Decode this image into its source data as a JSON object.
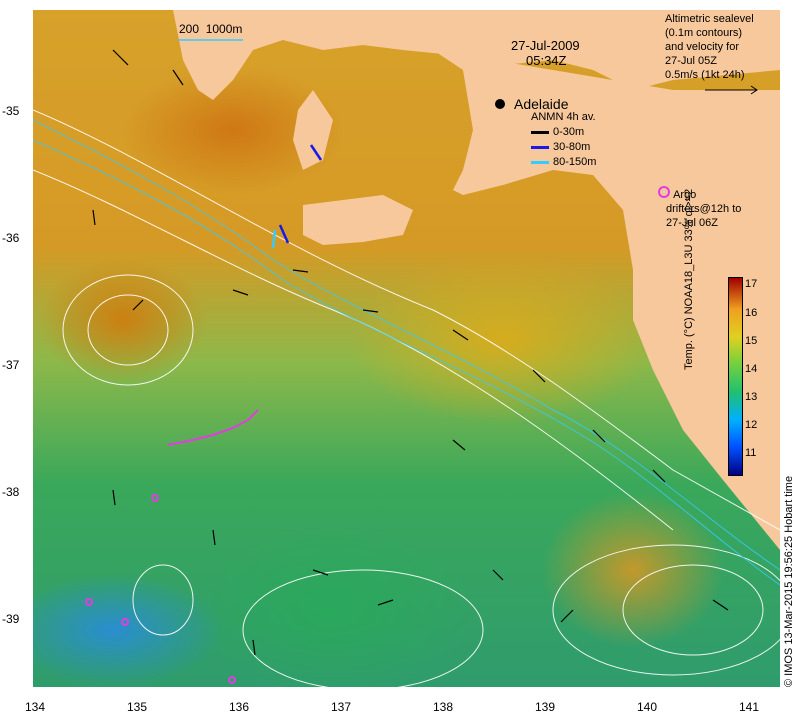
{
  "map": {
    "date": "27-Jul-2009",
    "time": "05:34Z",
    "scale_bar": "200",
    "scale_depth": "1000m",
    "city": "Adelaide"
  },
  "legend_sealevel": {
    "line1": "Altimetric sealevel",
    "line2": "(0.1m contours)",
    "line3": "and velocity for",
    "line4": "27-Jul 05Z",
    "line5": "0.5m/s (1kt 24h)"
  },
  "legend_anmn": {
    "title": "ANMN 4h av.",
    "items": [
      {
        "label": "0-30m",
        "color": "#000000"
      },
      {
        "label": "30-80m",
        "color": "#1a1ae6"
      },
      {
        "label": "80-150m",
        "color": "#33ccff"
      }
    ]
  },
  "legend_argo": {
    "line1": "Argo",
    "line2": "drifters@12h to",
    "line3": "27-Jul 06Z",
    "color": "#e23ce2"
  },
  "colorbar": {
    "title": "Temp. (°C) NOAA18_L3U 33% ql>=2",
    "ticks": [
      "11",
      "12",
      "13",
      "14",
      "15",
      "16",
      "17"
    ],
    "colors": [
      "#000080",
      "#0050ff",
      "#00b0ff",
      "#20c070",
      "#70d040",
      "#e0d020",
      "#f0a020",
      "#e05010",
      "#a00000"
    ]
  },
  "axes": {
    "x_ticks": [
      "134",
      "135",
      "136",
      "137",
      "138",
      "139",
      "140",
      "141"
    ],
    "y_ticks": [
      "-35",
      "-36",
      "-37",
      "-38",
      "-39"
    ]
  },
  "credit": "© IMOS 13-Mar-2015 19:56:25 Hobart time",
  "colors": {
    "land": "#f7c89b",
    "contour": "#ffffff"
  }
}
